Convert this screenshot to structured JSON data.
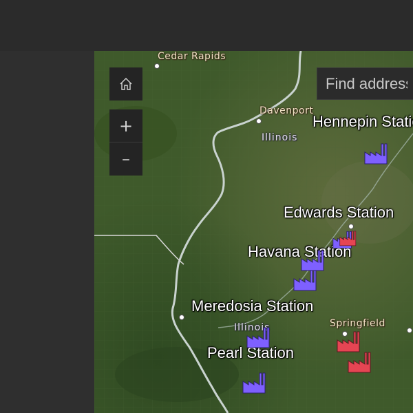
{
  "colors": {
    "plant_purple": "#7e60ff",
    "plant_red": "#e64553",
    "panel_bg": "#2b2b2b",
    "river": "#c9d3cf",
    "border": "#d9d9d9"
  },
  "controls": {
    "home_icon": "home-icon",
    "zoom_in_label": "+",
    "zoom_out_label": "–"
  },
  "search": {
    "placeholder": "Find address or place"
  },
  "labels": {
    "cities": [
      "Cedar Rapids",
      "Davenport",
      "Springfield"
    ],
    "regions": [
      "Illinois",
      "Illinois"
    ],
    "stations": [
      "Hennepin Station",
      "Edwards Station",
      "Havana Station",
      "Meredosia Station",
      "Pearl Station"
    ]
  },
  "plants": [
    {
      "color": "purple",
      "near": "Hennepin Station"
    },
    {
      "color": "purple",
      "near": "Edwards Station"
    },
    {
      "color": "red",
      "near": "Edwards Station"
    },
    {
      "color": "purple",
      "near": "Havana Station"
    },
    {
      "color": "purple",
      "near": "Havana Station"
    },
    {
      "color": "purple",
      "near": "Meredosia Station"
    },
    {
      "color": "red",
      "near": "Springfield"
    },
    {
      "color": "red",
      "near": "Springfield"
    },
    {
      "color": "purple",
      "near": "Pearl Station"
    }
  ]
}
